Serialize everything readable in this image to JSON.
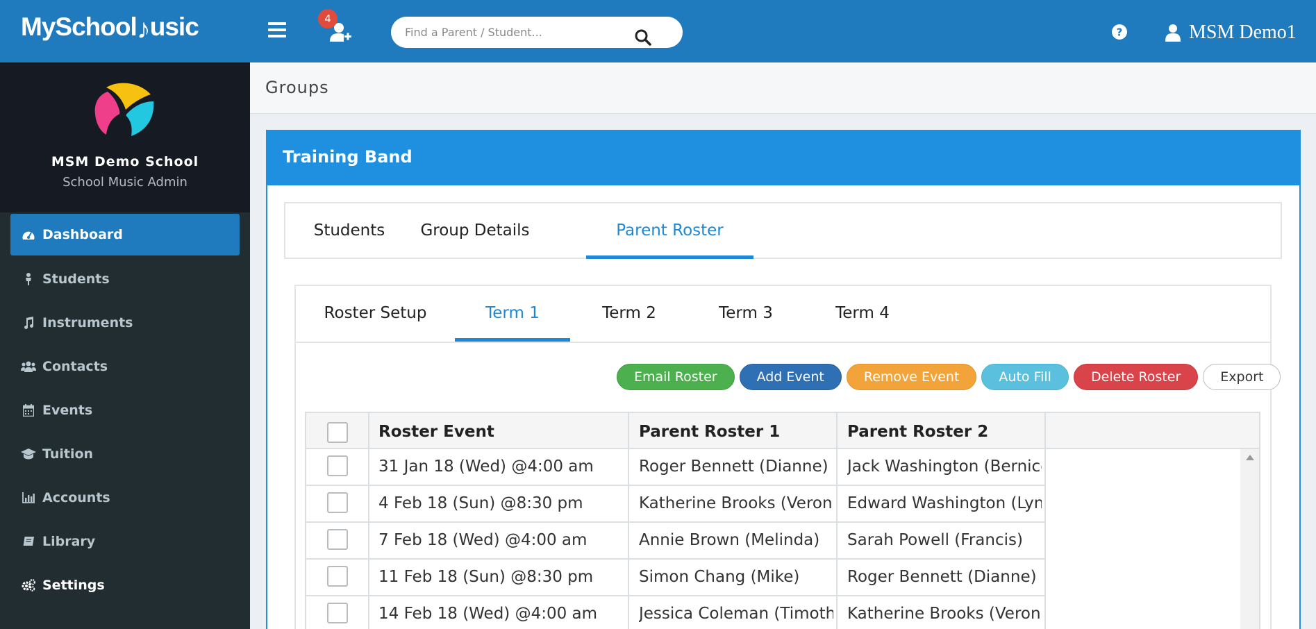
{
  "header": {
    "logo_text_1": "MySchool",
    "logo_note": "♪",
    "logo_text_2": "usic",
    "notification_count": "4",
    "search_placeholder": "Find a Parent / Student...",
    "user_name": "MSM Demo1",
    "icons": [
      "menu-icon",
      "add-user-icon",
      "search-icon",
      "help-icon",
      "user-icon"
    ]
  },
  "sidebar": {
    "school_name": "MSM Demo School",
    "school_role": "School Music Admin",
    "items": [
      {
        "label": "Dashboard",
        "icon": "dashboard-icon",
        "active": true
      },
      {
        "label": "Students",
        "icon": "student-icon"
      },
      {
        "label": "Instruments",
        "icon": "music-note-icon"
      },
      {
        "label": "Contacts",
        "icon": "contacts-icon"
      },
      {
        "label": "Events",
        "icon": "calendar-icon"
      },
      {
        "label": "Tuition",
        "icon": "graduation-cap-icon"
      },
      {
        "label": "Accounts",
        "icon": "bar-chart-icon"
      },
      {
        "label": "Library",
        "icon": "book-icon"
      },
      {
        "label": "Settings",
        "icon": "cogs-icon"
      }
    ]
  },
  "page": {
    "title": "Groups",
    "panel_title": "Training Band"
  },
  "outer_tabs": [
    {
      "label": "Students"
    },
    {
      "label": "Group Details"
    },
    {
      "label": "Parent Roster",
      "active": true
    }
  ],
  "inner_tabs": [
    {
      "label": "Roster Setup"
    },
    {
      "label": "Term 1",
      "active": true
    },
    {
      "label": "Term 2"
    },
    {
      "label": "Term 3"
    },
    {
      "label": "Term 4"
    }
  ],
  "actions": {
    "email_roster": "Email Roster",
    "add_event": "Add Event",
    "remove_event": "Remove Event",
    "auto_fill": "Auto Fill",
    "delete_roster": "Delete Roster",
    "export": "Export"
  },
  "table": {
    "columns": [
      "Roster Event",
      "Parent Roster 1",
      "Parent Roster 2"
    ],
    "rows": [
      {
        "event": "31 Jan 18 (Wed) @4:00 am",
        "roster1": "Roger Bennett (Dianne)",
        "roster2": "Jack Washington (Bernice"
      },
      {
        "event": "4 Feb 18 (Sun) @8:30 pm",
        "roster1": "Katherine Brooks (Veron",
        "roster2": "Edward Washington (Lyn"
      },
      {
        "event": "7 Feb 18 (Wed) @4:00 am",
        "roster1": "Annie Brown (Melinda)",
        "roster2": "Sarah Powell (Francis)"
      },
      {
        "event": "11 Feb 18 (Sun) @8:30 pm",
        "roster1": "Simon Chang (Mike)",
        "roster2": "Roger Bennett (Dianne)"
      },
      {
        "event": "14 Feb 18 (Wed) @4:00 am",
        "roster1": "Jessica Coleman (Timothy",
        "roster2": "Katherine Brooks (Veron"
      }
    ]
  },
  "colors": {
    "header_blue": "#1f7bbd",
    "panel_blue": "#1e90df",
    "active_tab": "#1e88d6",
    "sidebar_bg": "#222d32"
  }
}
